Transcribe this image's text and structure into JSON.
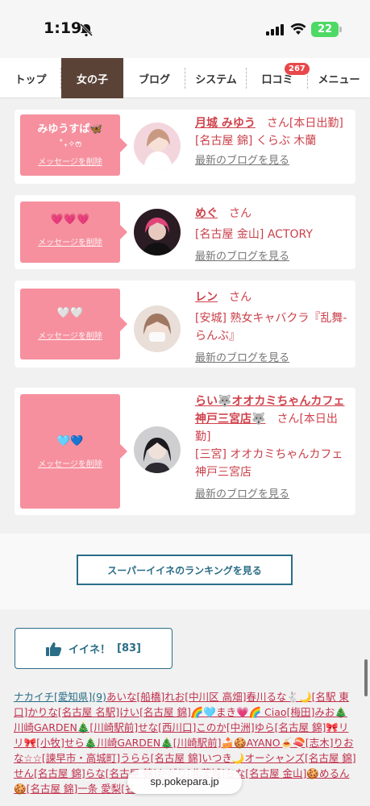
{
  "status": {
    "time": "1:19",
    "battery": "22"
  },
  "nav": {
    "tabs": [
      {
        "label": "トップ"
      },
      {
        "label": "女の子"
      },
      {
        "label": "ブログ"
      },
      {
        "label": "システム"
      },
      {
        "label": "口コミ"
      },
      {
        "label": "メニュー"
      }
    ],
    "badge": "267"
  },
  "cards": [
    {
      "message": "みゆうすぱ🦋",
      "message2": "˚₊✧ෆ",
      "delete": "メッセージを削除",
      "name": "月城 みゆう",
      "san": "さん",
      "status": "[本日出勤]",
      "shop": "[名古屋 錦] くらぶ 木蘭",
      "blog": "最新のブログを見る"
    },
    {
      "message": "💗💗💗",
      "delete": "メッセージを削除",
      "name": "めぐ",
      "san": "さん",
      "shop": "[名古屋 金山] ACTORY",
      "blog": "最新のブログを見る"
    },
    {
      "message": "🤍🤍",
      "delete": "メッセージを削除",
      "name": "レン",
      "san": "さん",
      "shop": "[安城] 熟女キャバクラ『乱舞-らんぶ』",
      "blog": "最新のブログを見る"
    },
    {
      "message": "🩵💙",
      "delete": "メッセージを削除",
      "name": "らい🐺オオカミちゃんカフェ神戸三宮店🐺",
      "san": "さん",
      "status": "[本日出勤]",
      "shop": "[三宮] オオカミちゃんカフェ神戸三宮店",
      "blog": "最新のブログを見る"
    }
  ],
  "ranking_button": "スーパーイイネのランキングを見る",
  "like": {
    "label": "イイネ！",
    "count": "[83]"
  },
  "likes_list": {
    "first": "ナカイチ[愛知県](9)",
    "rest": "あいな[船橋]れお[中川区 高畑]春川るな🐇🌙[名駅 東口]かりな[名古屋 名駅]けい[名古屋 錦]🌈🩵まき💗🌈 Ciao[梅田]みお🎄川崎GARDEN🎄[川崎駅前]せな[西川口]このか[中洲]ゆら[名古屋 錦]🎀リリ🎀[小牧]せら🎄川崎GARDEN🎄[川崎駅前]🍰🍪AYANO🍝🍣[志木]りおな☆☆[諫早市・高城町]うらら[名古屋 錦]いつき🌙オーシャンズ[名古屋 錦]せん[名古屋 錦]らな[名古屋 錦]かがり[北茨城]ちな[名古屋 金山]🍪めるん🍪[名古屋 錦]一条 愛梨[名"
  },
  "url": "sp.pokepara.jp"
}
